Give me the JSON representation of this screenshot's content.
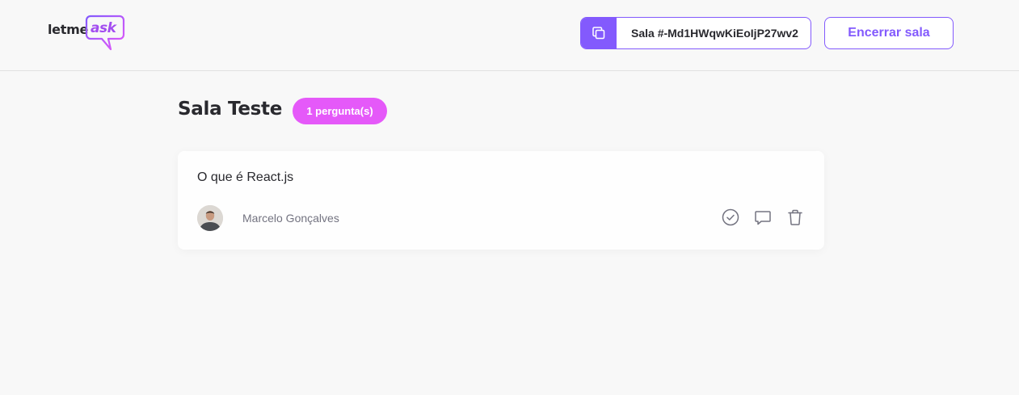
{
  "header": {
    "logo": {
      "word1": "letme",
      "word2": "ask"
    },
    "room_code": {
      "label": "Sala #-Md1HWqwKiEoIjP27wv2"
    },
    "end_room_label": "Encerrar sala"
  },
  "main": {
    "room_title": "Sala Teste",
    "question_count_label": "1 pergunta(s)",
    "questions": [
      {
        "content": "O que é React.js",
        "author": "Marcelo Gonçalves"
      }
    ]
  },
  "colors": {
    "primary": "#835afd",
    "badge": "#e559f9",
    "background": "#f8f8f8"
  },
  "icons": [
    "copy-icon",
    "check-circle-icon",
    "chat-bubble-icon",
    "trash-icon"
  ]
}
